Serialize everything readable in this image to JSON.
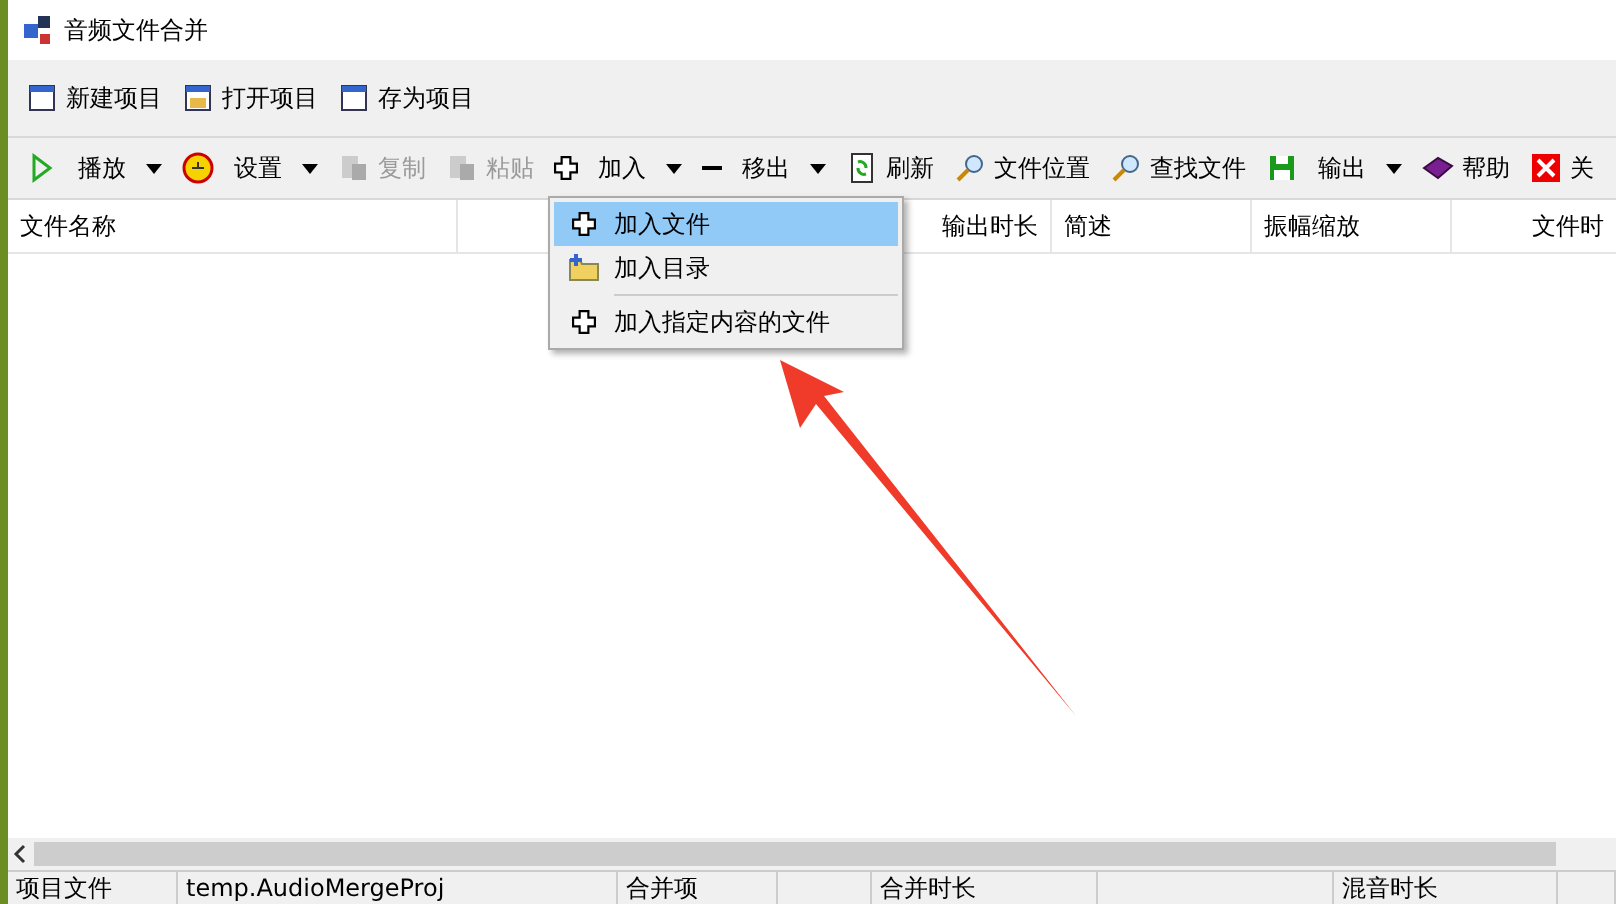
{
  "window": {
    "title": "音频文件合并"
  },
  "project_toolbar": [
    {
      "label": "新建项目"
    },
    {
      "label": "打开项目"
    },
    {
      "label": "存为项目"
    }
  ],
  "toolbar": [
    {
      "label": "播放",
      "dropdown": true,
      "disabled": false
    },
    {
      "label": "设置",
      "dropdown": true,
      "disabled": false
    },
    {
      "label": "复制",
      "dropdown": false,
      "disabled": true
    },
    {
      "label": "粘贴",
      "dropdown": false,
      "disabled": true
    },
    {
      "label": "加入",
      "dropdown": true,
      "disabled": false
    },
    {
      "label": "移出",
      "dropdown": true,
      "disabled": false
    },
    {
      "label": "刷新",
      "dropdown": false,
      "disabled": false
    },
    {
      "label": "文件位置",
      "dropdown": false,
      "disabled": false
    },
    {
      "label": "查找文件",
      "dropdown": false,
      "disabled": false
    },
    {
      "label": "输出",
      "dropdown": true,
      "disabled": false
    },
    {
      "label": "帮助",
      "dropdown": false,
      "disabled": false
    },
    {
      "label": "关",
      "dropdown": false,
      "disabled": false
    }
  ],
  "table": {
    "columns": [
      "文件名称",
      "输出时长",
      "简述",
      "振幅缩放",
      "文件时"
    ]
  },
  "menu": {
    "items": [
      {
        "label": "加入文件",
        "selected": true,
        "separator_before": false
      },
      {
        "label": "加入目录",
        "selected": false,
        "separator_before": false
      },
      {
        "label": "加入指定内容的文件",
        "selected": false,
        "separator_before": true
      }
    ]
  },
  "status_bar": [
    "项目文件",
    "temp.AudioMergeProj",
    "合并项",
    "合并时长",
    "混音时长"
  ]
}
